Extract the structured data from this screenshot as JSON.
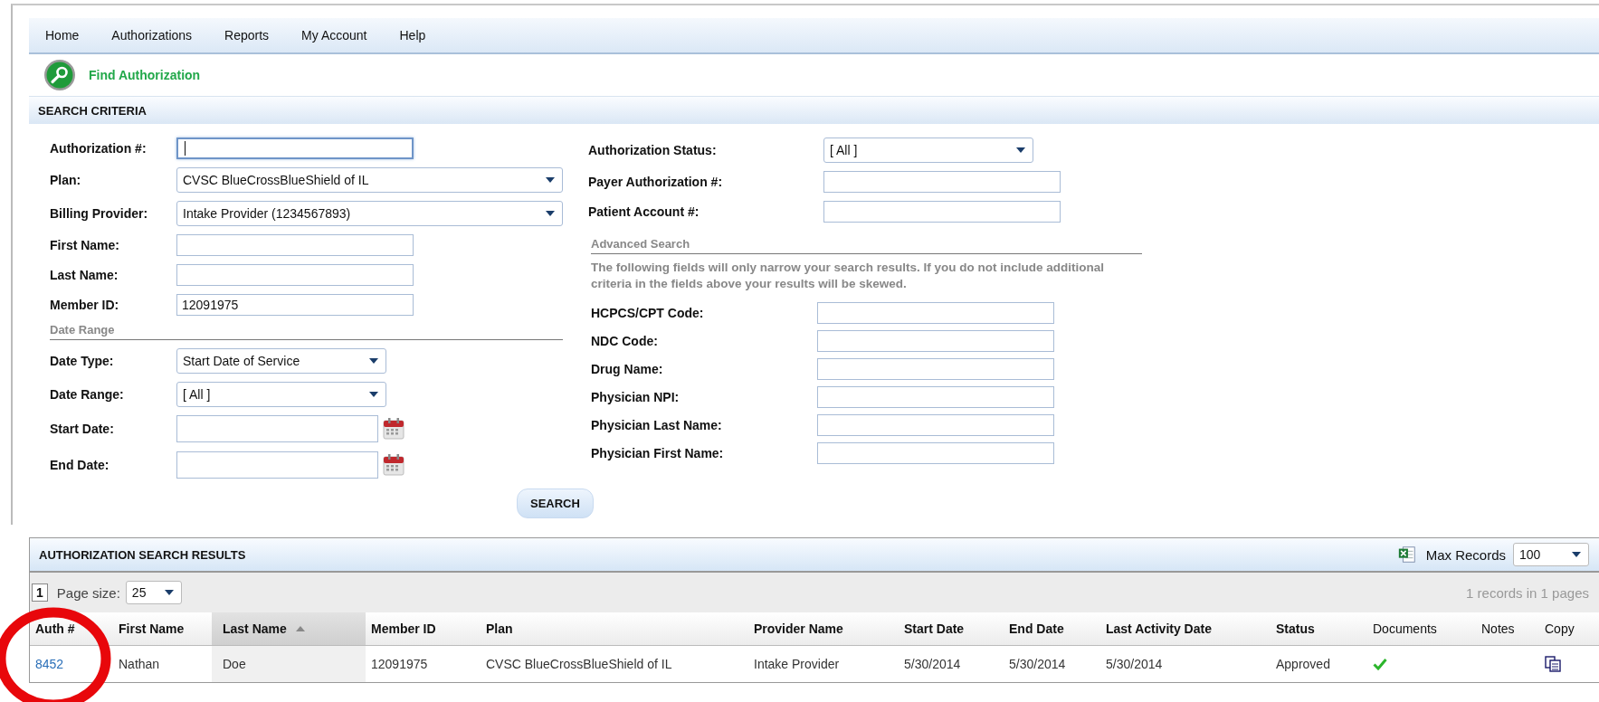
{
  "menu": [
    "Home",
    "Authorizations",
    "Reports",
    "My Account",
    "Help"
  ],
  "page_title": "Find Authorization",
  "search_criteria": {
    "title": "SEARCH CRITERIA",
    "left": {
      "fields": [
        {
          "kind": "text",
          "label": "Authorization #:",
          "focused": true
        },
        {
          "kind": "wideselect",
          "label": "Plan:",
          "value": "CVSC BlueCrossBlueShield of IL"
        },
        {
          "kind": "wideselect",
          "label": "Billing Provider:",
          "value": "Intake Provider (1234567893)"
        },
        {
          "kind": "text",
          "label": "First Name:",
          "focused": false
        },
        {
          "kind": "text",
          "label": "Last Name:",
          "focused": false
        },
        {
          "kind": "text",
          "label": "Member ID:",
          "value": "12091975",
          "focused": false
        }
      ],
      "section": {
        "title": "Date Range",
        "fields": [
          {
            "kind": "select",
            "label": "Date Type:",
            "value": "Start Date of Service"
          },
          {
            "kind": "select",
            "label": "Date Range:",
            "value": "[ All ]"
          },
          {
            "kind": "date",
            "label": "Start Date:"
          },
          {
            "kind": "date",
            "label": "End Date:"
          }
        ]
      }
    },
    "right": {
      "fields": [
        {
          "kind": "select",
          "label": "Authorization Status:",
          "value": "[ All ]"
        },
        {
          "kind": "text",
          "label": "Payer Authorization #:",
          "focused": false
        },
        {
          "kind": "text",
          "label": "Patient Account #:",
          "focused": false
        }
      ],
      "section": {
        "title": "Advanced Search",
        "note": "The following fields will only narrow your search results. If you do not include additional criteria in the fields above your results will be skewed.",
        "fields": [
          {
            "kind": "text",
            "label": "HCPCS/CPT Code:",
            "focused": false
          },
          {
            "kind": "text",
            "label": "NDC Code:",
            "focused": false
          },
          {
            "kind": "text",
            "label": "Drug Name:",
            "focused": false
          },
          {
            "kind": "text",
            "label": "Physician NPI:",
            "focused": false
          },
          {
            "kind": "text",
            "label": "Physician Last Name:",
            "focused": false
          },
          {
            "kind": "text",
            "label": "Physician First Name:",
            "focused": false
          }
        ]
      }
    }
  },
  "search_button": "SEARCH",
  "results": {
    "title": "AUTHORIZATION SEARCH RESULTS",
    "max_records_label": "Max Records",
    "max_records": "100",
    "pages": [
      {
        "label": "1",
        "selected": true
      }
    ],
    "page_size_label": "Page size:",
    "page_size": "25",
    "summary": "1 records in 1 pages",
    "columns": [
      {
        "label": "Auth #",
        "sorted": false
      },
      {
        "label": "First Name",
        "sorted": false
      },
      {
        "label": "Last Name",
        "sorted": true
      },
      {
        "label": "Member ID",
        "sorted": false
      },
      {
        "label": "Plan",
        "sorted": false
      },
      {
        "label": "Provider Name",
        "sorted": false
      },
      {
        "label": "Start Date",
        "sorted": false
      },
      {
        "label": "End Date",
        "sorted": false
      },
      {
        "label": "Last Activity Date",
        "sorted": false
      },
      {
        "label": "Status",
        "sorted": false
      },
      {
        "label": "Documents",
        "sorted": false
      },
      {
        "label": "Notes",
        "sorted": false
      },
      {
        "label": "Copy",
        "sorted": false
      }
    ],
    "rows": [
      {
        "cells": [
          {
            "kind": "link",
            "text": "8452"
          },
          {
            "kind": "text",
            "text": "Nathan"
          },
          {
            "kind": "text",
            "text": "Doe"
          },
          {
            "kind": "text",
            "text": "12091975"
          },
          {
            "kind": "text",
            "text": "CVSC BlueCrossBlueShield of IL"
          },
          {
            "kind": "text",
            "text": "Intake Provider"
          },
          {
            "kind": "text",
            "text": "5/30/2014"
          },
          {
            "kind": "text",
            "text": "5/30/2014"
          },
          {
            "kind": "text",
            "text": "5/30/2014"
          },
          {
            "kind": "text",
            "text": "Approved"
          },
          {
            "kind": "check"
          },
          {
            "kind": "blank"
          },
          {
            "kind": "copy"
          }
        ]
      }
    ]
  }
}
